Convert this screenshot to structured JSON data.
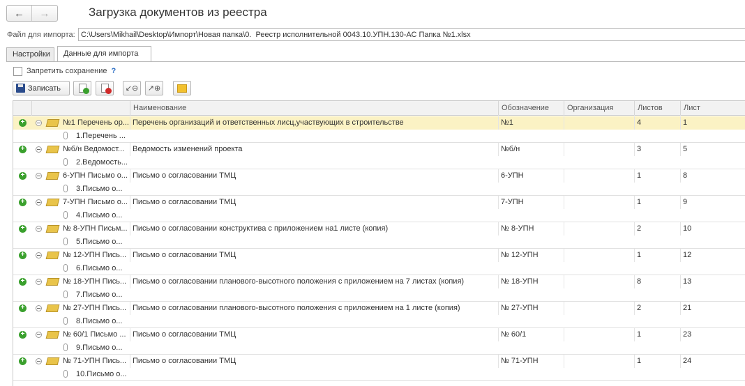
{
  "title": "Загрузка документов из реестра",
  "nav": {
    "back": "←",
    "forward": "→"
  },
  "file": {
    "label": "Файл для импорта:",
    "value": "C:\\Users\\Mikhail\\Desktop\\Импорт\\Новая папка\\0.  Реестр исполнительной 0043.10.УПН.130-АС Папка №1.xlsx"
  },
  "tabs": [
    {
      "label": "Настройки",
      "active": false
    },
    {
      "label": "Данные для импорта",
      "active": true
    }
  ],
  "prohibit_save": {
    "label": "Запретить сохранение",
    "help": "?",
    "checked": false
  },
  "toolbar": {
    "save_label": "Записать"
  },
  "grid": {
    "columns": [
      "Наименование",
      "Обозначение",
      "Организация",
      "Листов",
      "Лист"
    ],
    "rows": [
      {
        "tree": "№1 Перечень ор...",
        "child": "1.Перечень ...",
        "name": "Перечень организаций и ответственных лисц,участвующих в строительстве",
        "code": "№1",
        "org": "",
        "sheets": "4",
        "sheet": "1",
        "selected": true
      },
      {
        "tree": "№б/н Ведомост...",
        "child": "2.Ведомость...",
        "name": "Ведомость изменений проекта",
        "code": "№б/н",
        "org": "",
        "sheets": "3",
        "sheet": "5"
      },
      {
        "tree": "6-УПН Письмо о...",
        "child": "3.Письмо о...",
        "name": "Письмо о согласовании ТМЦ",
        "code": "6-УПН",
        "org": "",
        "sheets": "1",
        "sheet": "8"
      },
      {
        "tree": "7-УПН Письмо о...",
        "child": "4.Письмо о...",
        "name": "Письмо о согласовании ТМЦ",
        "code": "7-УПН",
        "org": "",
        "sheets": "1",
        "sheet": "9"
      },
      {
        "tree": "№ 8-УПН Письм...",
        "child": "5.Письмо о...",
        "name": "Письмо о согласовании конструктива с приложением на1 листе (копия)",
        "code": "№ 8-УПН",
        "org": "",
        "sheets": "2",
        "sheet": "10"
      },
      {
        "tree": "№ 12-УПН Пись...",
        "child": "6.Письмо о...",
        "name": "Письмо о согласовании ТМЦ",
        "code": "№ 12-УПН",
        "org": "",
        "sheets": "1",
        "sheet": "12"
      },
      {
        "tree": "№ 18-УПН Пись...",
        "child": "7.Письмо о...",
        "name": "Письмо о согласовании планового-высотного положения с приложением на 7 листах (копия)",
        "code": "№ 18-УПН",
        "org": "",
        "sheets": "8",
        "sheet": "13"
      },
      {
        "tree": "№ 27-УПН Пись...",
        "child": "8.Письмо о...",
        "name": "Письмо о согласовании планового-высотного положения с приложением на 1 листе (копия)",
        "code": "№ 27-УПН",
        "org": "",
        "sheets": "2",
        "sheet": "21"
      },
      {
        "tree": "№ 60/1 Письмо ...",
        "child": "9.Письмо о...",
        "name": "Письмо о согласовании ТМЦ",
        "code": "№ 60/1",
        "org": "",
        "sheets": "1",
        "sheet": "23"
      },
      {
        "tree": "№ 71-УПН Пись...",
        "child": "10.Письмо о...",
        "name": "Письмо о согласовании ТМЦ",
        "code": "№ 71-УПН",
        "org": "",
        "sheets": "1",
        "sheet": "24"
      }
    ]
  }
}
